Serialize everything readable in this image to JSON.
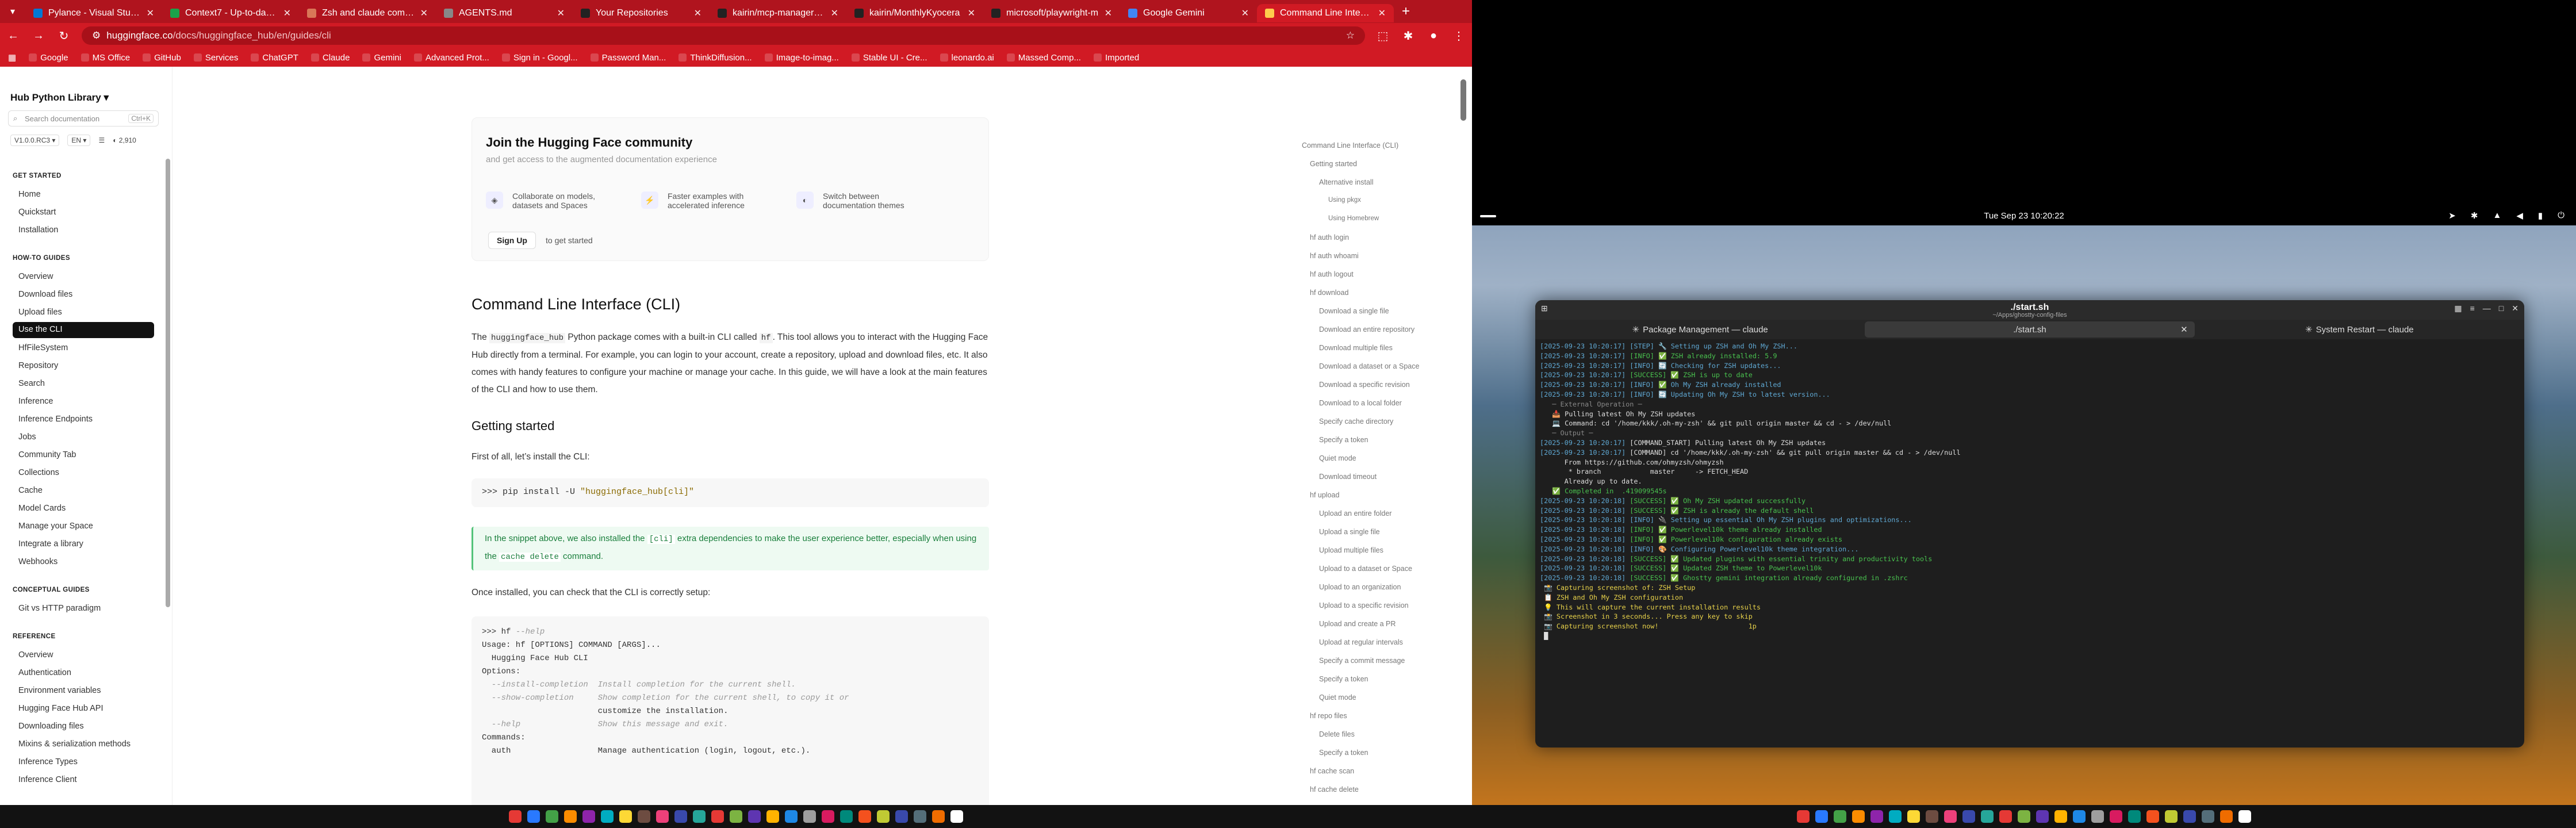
{
  "browser": {
    "tabs": [
      {
        "label": "Pylance - Visual Studio M",
        "icon": "vscode-icon",
        "color": "#0078d4"
      },
      {
        "label": "Context7 - Up-to-date d",
        "icon": "context7-icon",
        "color": "#1aa34a"
      },
      {
        "label": "Zsh and claude commo",
        "icon": "claude-icon",
        "color": "#d97757"
      },
      {
        "label": "AGENTS.md",
        "icon": "file-icon",
        "color": "#888888"
      },
      {
        "label": "Your Repositories",
        "icon": "github-icon",
        "color": "#222222"
      },
      {
        "label": "kairin/mcp-manager: Mi",
        "icon": "github-icon",
        "color": "#222222"
      },
      {
        "label": "kairin/MonthlyKyocera",
        "icon": "github-icon",
        "color": "#222222"
      },
      {
        "label": "microsoft/playwright-m",
        "icon": "github-icon",
        "color": "#222222"
      },
      {
        "label": "Google Gemini",
        "icon": "gemini-icon",
        "color": "#4285f4"
      },
      {
        "label": "Command Line Interfac",
        "icon": "huggingface-icon",
        "color": "#ffcc4d"
      }
    ],
    "url_domain": "huggingface.co",
    "url_path": "/docs/huggingface_hub/en/guides/cli",
    "bookmarks": [
      "Google",
      "MS Office",
      "GitHub",
      "Services",
      "ChatGPT",
      "Claude",
      "Gemini",
      "Advanced Prot...",
      "Sign in - Googl...",
      "Password Man...",
      "ThinkDiffusion...",
      "Image-to-imag...",
      "Stable UI - Cre...",
      "leonardo.ai",
      "Massed Comp...",
      "Imported"
    ]
  },
  "sidebar": {
    "title": "Hub Python Library",
    "search_placeholder": "Search documentation",
    "search_kbd": "Ctrl+K",
    "version": "V1.0.0.RC3",
    "lang": "EN",
    "stars": "2,910",
    "sections": [
      {
        "title": "GET STARTED",
        "items": [
          "Home",
          "Quickstart",
          "Installation"
        ]
      },
      {
        "title": "HOW-TO GUIDES",
        "items": [
          "Overview",
          "Download files",
          "Upload files",
          "Use the CLI",
          "HfFileSystem",
          "Repository",
          "Search",
          "Inference",
          "Inference Endpoints",
          "Jobs",
          "Community Tab",
          "Collections",
          "Cache",
          "Model Cards",
          "Manage your Space",
          "Integrate a library",
          "Webhooks"
        ]
      },
      {
        "title": "CONCEPTUAL GUIDES",
        "items": [
          "Git vs HTTP paradigm"
        ]
      },
      {
        "title": "REFERENCE",
        "items": [
          "Overview",
          "Authentication",
          "Environment variables",
          "Hugging Face Hub API",
          "Downloading files",
          "Mixins & serialization methods",
          "Inference Types",
          "Inference Client"
        ]
      }
    ],
    "active_item": "Use the CLI"
  },
  "join": {
    "title": "Join the Hugging Face community",
    "subtitle": "and get access to the augmented documentation experience",
    "features": [
      {
        "icon": "collaborate-icon",
        "text": "Collaborate on models, datasets and Spaces"
      },
      {
        "icon": "lightning-icon",
        "text": "Faster examples with accelerated inference"
      },
      {
        "icon": "theme-icon",
        "text": "Switch between documentation themes"
      }
    ],
    "signup": "Sign Up",
    "signup_note": "to get started"
  },
  "article": {
    "h1": "Command Line Interface (CLI)",
    "intro_a": "The ",
    "intro_code": "huggingface_hub",
    "intro_b": " Python package comes with a built-in CLI called ",
    "intro_code2": "hf",
    "intro_c": ". This tool allows you to interact with the Hugging Face Hub directly from a terminal. For example, you can login to your account, create a repository, upload and download files, etc. It also comes with handy features to configure your machine or manage your cache. In this guide, we will have a look at the main features of the CLI and how to use them.",
    "h2": "Getting started",
    "install_text": "First of all, let’s install the CLI:",
    "install_cmd": ">>> pip install -U ",
    "install_pkg": "\"huggingface_hub[cli]\"",
    "tip_a": "In the snippet above, we also installed the ",
    "tip_code": "[cli]",
    "tip_b": " extra dependencies to make the user experience better, especially when using the ",
    "tip_code2": "cache delete",
    "tip_c": " command.",
    "check_text": "Once installed, you can check that the CLI is correctly setup:",
    "code_lines": [
      {
        "t": ">>> hf ",
        "c": "--help"
      },
      {
        "t": "Usage: hf [OPTIONS] COMMAND [ARGS]...",
        "c": ""
      },
      {
        "t": "",
        "c": ""
      },
      {
        "t": "  Hugging Face Hub CLI",
        "c": ""
      },
      {
        "t": "",
        "c": ""
      },
      {
        "t": "Options:",
        "c": ""
      },
      {
        "t": "",
        "c": "  --install-completion  Install completion for the current shell."
      },
      {
        "t": "",
        "c": "  --show-completion     Show completion for the current shell, to copy it or"
      },
      {
        "t": "                        customize the installation.",
        "c": ""
      },
      {
        "t": "",
        "c": "  --help                Show this message and exit."
      },
      {
        "t": "",
        "c": ""
      },
      {
        "t": "Commands:",
        "c": ""
      },
      {
        "t": "  auth                  Manage authentication (login, logout, etc.).",
        "c": ""
      }
    ]
  },
  "toc": [
    {
      "label": "Command Line Interface (CLI)",
      "level": 0
    },
    {
      "label": "Getting started",
      "level": 1
    },
    {
      "label": "Alternative install",
      "level": 2
    },
    {
      "label": "Using pkgx",
      "level": 3
    },
    {
      "label": "Using Homebrew",
      "level": 3
    },
    {
      "label": "hf auth login",
      "level": 1
    },
    {
      "label": "hf auth whoami",
      "level": 1
    },
    {
      "label": "hf auth logout",
      "level": 1
    },
    {
      "label": "hf download",
      "level": 1
    },
    {
      "label": "Download a single file",
      "level": 2
    },
    {
      "label": "Download an entire repository",
      "level": 2
    },
    {
      "label": "Download multiple files",
      "level": 2
    },
    {
      "label": "Download a dataset or a Space",
      "level": 2
    },
    {
      "label": "Download a specific revision",
      "level": 2
    },
    {
      "label": "Download to a local folder",
      "level": 2
    },
    {
      "label": "Specify cache directory",
      "level": 2
    },
    {
      "label": "Specify a token",
      "level": 2
    },
    {
      "label": "Quiet mode",
      "level": 2
    },
    {
      "label": "Download timeout",
      "level": 2
    },
    {
      "label": "hf upload",
      "level": 1
    },
    {
      "label": "Upload an entire folder",
      "level": 2
    },
    {
      "label": "Upload a single file",
      "level": 2
    },
    {
      "label": "Upload multiple files",
      "level": 2
    },
    {
      "label": "Upload to a dataset or Space",
      "level": 2
    },
    {
      "label": "Upload to an organization",
      "level": 2
    },
    {
      "label": "Upload to a specific revision",
      "level": 2
    },
    {
      "label": "Upload and create a PR",
      "level": 2
    },
    {
      "label": "Upload at regular intervals",
      "level": 2
    },
    {
      "label": "Specify a commit message",
      "level": 2
    },
    {
      "label": "Specify a token",
      "level": 2
    },
    {
      "label": "Quiet mode",
      "level": 2
    },
    {
      "label": "hf repo files",
      "level": 1
    },
    {
      "label": "Delete files",
      "level": 2
    },
    {
      "label": "Specify a token",
      "level": 2
    },
    {
      "label": "hf cache scan",
      "level": 1
    },
    {
      "label": "hf cache delete",
      "level": 1
    }
  ],
  "gnome": {
    "clock": "Tue Sep 23  10:20:22"
  },
  "terminal": {
    "title": "./start.sh",
    "subtitle": "~/Apps/ghostty-config-files",
    "tabs": [
      "Package Management — claude",
      "./start.sh",
      "System Restart — claude"
    ],
    "active_tab": 1,
    "lines": [
      {
        "k": "info",
        "ts": "[2025-09-23 10:20:17]",
        "lv": "[STEP]",
        "msg": " 🔧 Setting up ZSH and Oh My ZSH..."
      },
      {
        "k": "ok",
        "ts": "[2025-09-23 10:20:17]",
        "lv": "[INFO]",
        "msg": " ✅ ZSH already installed: 5.9"
      },
      {
        "k": "info",
        "ts": "[2025-09-23 10:20:17]",
        "lv": "[INFO]",
        "msg": " 🔄 Checking for ZSH updates..."
      },
      {
        "k": "ok",
        "ts": "[2025-09-23 10:20:17]",
        "lv": "[SUCCESS]",
        "msg": " ✅ ZSH is up to date"
      },
      {
        "k": "info",
        "ts": "[2025-09-23 10:20:17]",
        "lv": "[INFO]",
        "msg": " ✅ Oh My ZSH already installed"
      },
      {
        "k": "info",
        "ts": "[2025-09-23 10:20:17]",
        "lv": "[INFO]",
        "msg": " 🔄 Updating Oh My ZSH to latest version..."
      },
      {
        "k": "dim",
        "ts": "",
        "lv": "",
        "msg": "   ─ External Operation ─"
      },
      {
        "k": "plain",
        "ts": "",
        "lv": "",
        "msg": ""
      },
      {
        "k": "plain",
        "ts": "",
        "lv": "",
        "msg": "   📥 Pulling latest Oh My ZSH updates"
      },
      {
        "k": "cmd",
        "ts": "",
        "lv": "",
        "msg": "   💻 Command: cd '/home/kkk/.oh-my-zsh' && git pull origin master && cd - > /dev/null"
      },
      {
        "k": "dim",
        "ts": "",
        "lv": "",
        "msg": "   ─ Output ─"
      },
      {
        "k": "cmd",
        "ts": "[2025-09-23 10:20:17]",
        "lv": "",
        "msg": " [COMMAND_START] Pulling latest Oh My ZSH updates"
      },
      {
        "k": "cmd",
        "ts": "[2025-09-23 10:20:17]",
        "lv": "",
        "msg": " [COMMAND] cd '/home/kkk/.oh-my-zsh' && git pull origin master && cd - > /dev/null"
      },
      {
        "k": "plain",
        "ts": "",
        "lv": "",
        "msg": ""
      },
      {
        "k": "plain",
        "ts": "",
        "lv": "",
        "msg": "      From https://github.com/ohmyzsh/ohmyzsh"
      },
      {
        "k": "plain",
        "ts": "",
        "lv": "",
        "msg": "       * branch            master     -> FETCH_HEAD"
      },
      {
        "k": "plain",
        "ts": "",
        "lv": "",
        "msg": "      Already up to date."
      },
      {
        "k": "plain",
        "ts": "",
        "lv": "",
        "msg": ""
      },
      {
        "k": "ok",
        "ts": "",
        "lv": "",
        "msg": "   ✅ Completed in  .419099545s"
      },
      {
        "k": "ok",
        "ts": "[2025-09-23 10:20:18]",
        "lv": "[SUCCESS]",
        "msg": " ✅ Oh My ZSH updated successfully"
      },
      {
        "k": "ok",
        "ts": "[2025-09-23 10:20:18]",
        "lv": "[SUCCESS]",
        "msg": " ✅ ZSH is already the default shell"
      },
      {
        "k": "info",
        "ts": "[2025-09-23 10:20:18]",
        "lv": "[INFO]",
        "msg": " 🔌 Setting up essential Oh My ZSH plugins and optimizations..."
      },
      {
        "k": "ok",
        "ts": "[2025-09-23 10:20:18]",
        "lv": "[INFO]",
        "msg": " ✅ Powerlevel10k theme already installed"
      },
      {
        "k": "ok",
        "ts": "[2025-09-23 10:20:18]",
        "lv": "[INFO]",
        "msg": " ✅ Powerlevel10k configuration already exists"
      },
      {
        "k": "info",
        "ts": "[2025-09-23 10:20:18]",
        "lv": "[INFO]",
        "msg": " 🎨 Configuring Powerlevel10k theme integration..."
      },
      {
        "k": "ok",
        "ts": "[2025-09-23 10:20:18]",
        "lv": "[SUCCESS]",
        "msg": " ✅ Updated plugins with essential trinity and productivity tools"
      },
      {
        "k": "ok",
        "ts": "[2025-09-23 10:20:18]",
        "lv": "[SUCCESS]",
        "msg": " ✅ Updated ZSH theme to Powerlevel10k"
      },
      {
        "k": "ok",
        "ts": "[2025-09-23 10:20:18]",
        "lv": "[SUCCESS]",
        "msg": " ✅ Ghostty gemini integration already configured in .zshrc"
      },
      {
        "k": "plain",
        "ts": "",
        "lv": "",
        "msg": ""
      },
      {
        "k": "warn",
        "ts": "",
        "lv": "",
        "msg": " 📸 Capturing screenshot of: ZSH Setup"
      },
      {
        "k": "warn",
        "ts": "",
        "lv": "",
        "msg": " 📋 ZSH and Oh My ZSH configuration"
      },
      {
        "k": "warn",
        "ts": "",
        "lv": "",
        "msg": " 💡 This will capture the current installation results"
      },
      {
        "k": "plain",
        "ts": "",
        "lv": "",
        "msg": ""
      },
      {
        "k": "warn",
        "ts": "",
        "lv": "",
        "msg": " 📸 Screenshot in 3 seconds... Press any key to skip"
      },
      {
        "k": "warn",
        "ts": "",
        "lv": "",
        "msg": " 📷 Capturing screenshot now!                      1p"
      },
      {
        "k": "plain",
        "ts": "",
        "lv": "",
        "msg": " █"
      }
    ]
  }
}
